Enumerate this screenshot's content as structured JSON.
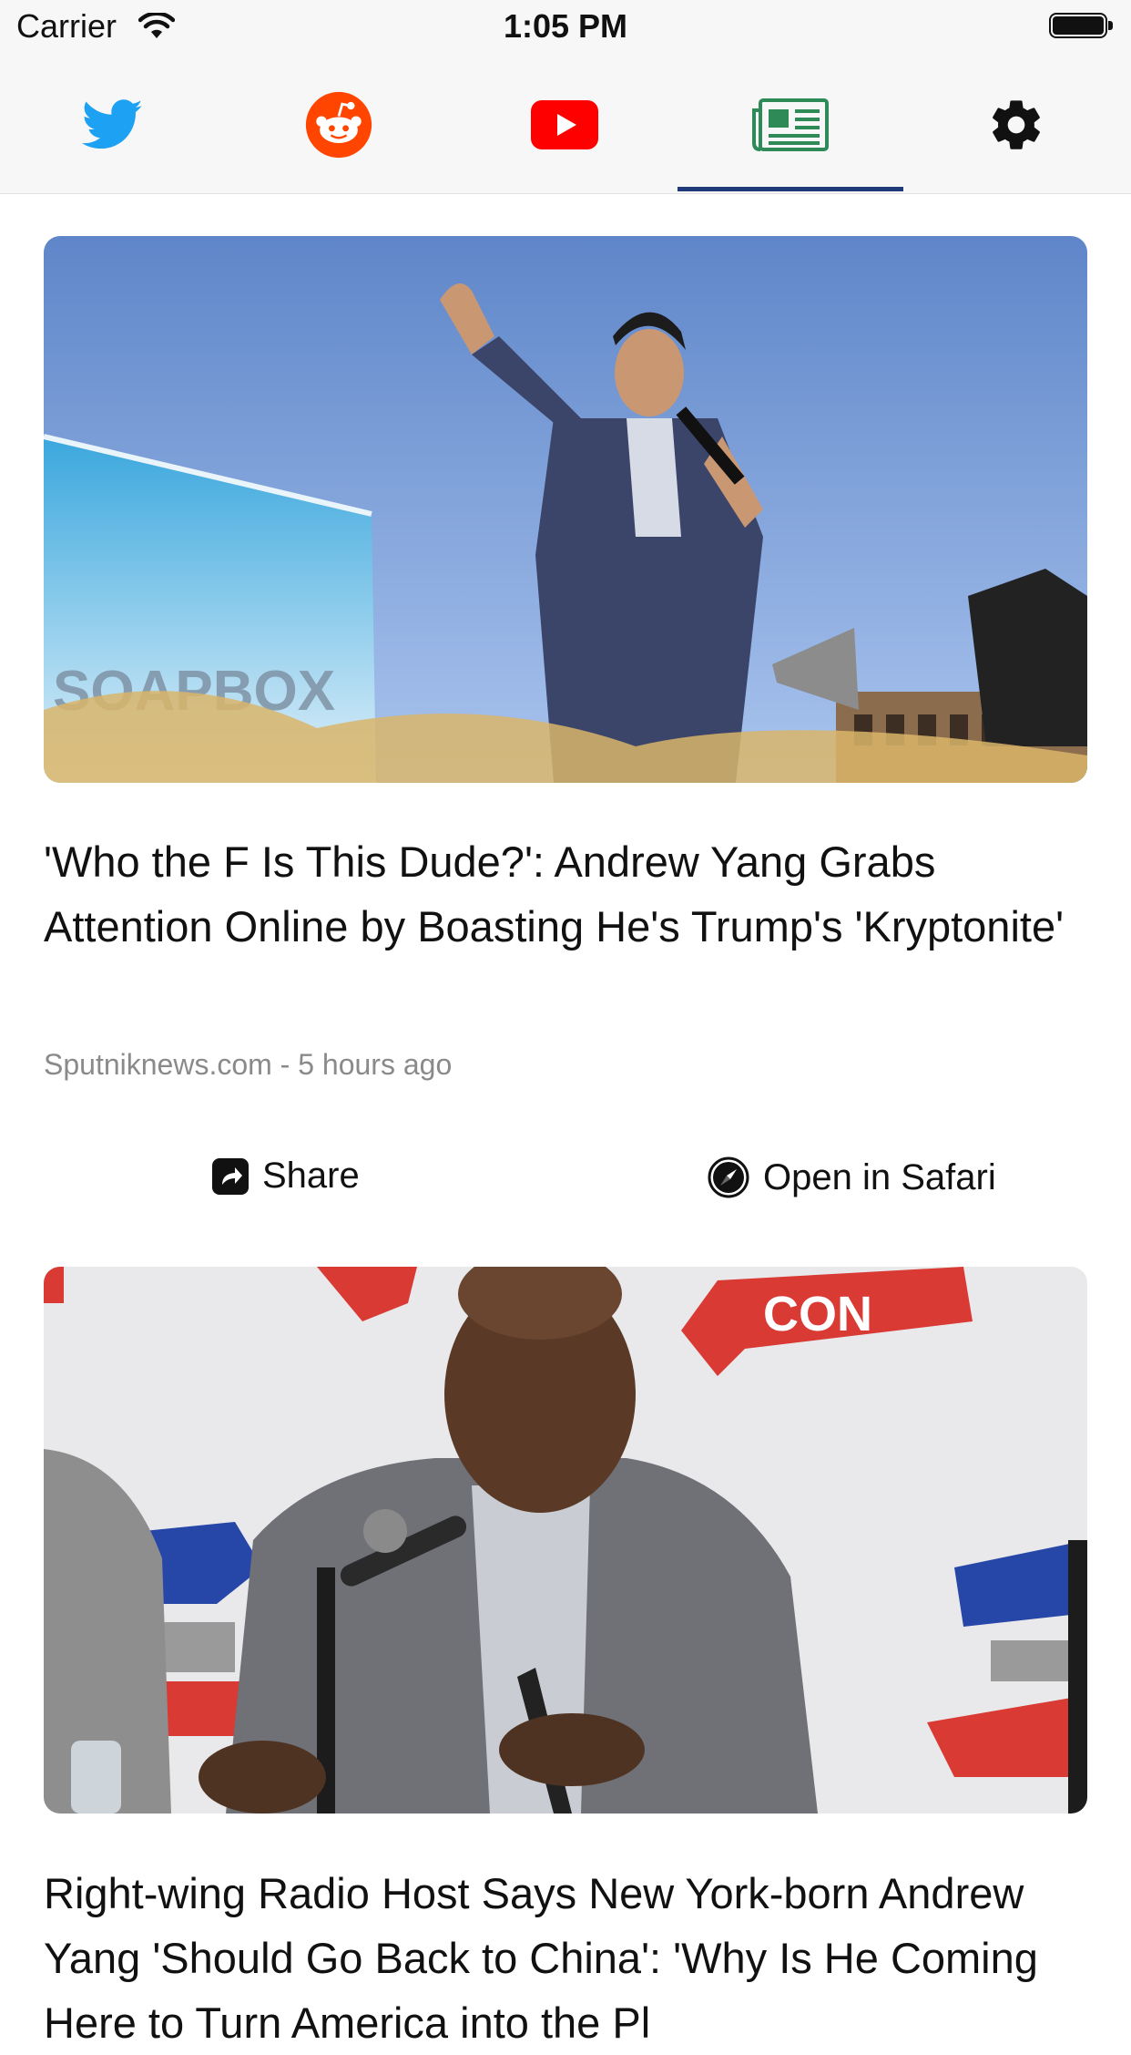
{
  "status_bar": {
    "carrier": "Carrier",
    "time": "1:05 PM"
  },
  "tabs": [
    {
      "icon": "twitter-icon",
      "color": "#1da1f2",
      "active": false
    },
    {
      "icon": "reddit-icon",
      "color": "#ff4500",
      "active": false
    },
    {
      "icon": "youtube-icon",
      "color": "#ff0000",
      "active": false
    },
    {
      "icon": "newspaper-icon",
      "color": "#2e8b57",
      "active": true
    },
    {
      "icon": "gear-icon",
      "color": "#111111",
      "active": false
    }
  ],
  "articles": [
    {
      "headline": "'Who the F Is This Dude?': Andrew Yang Grabs Attention Online by Boasting He's Trump's 'Kryptonite'",
      "meta": "Sputniknews.com - 5 hours ago",
      "image_banner_text": "SOAPBOX",
      "share_label": "Share",
      "safari_label": "Open in Safari"
    },
    {
      "headline": "Right-wing Radio Host Says New York-born Andrew Yang 'Should Go Back to China': 'Why Is He Coming Here to Turn America into the Pl",
      "image_banner_text": "CON"
    }
  ],
  "colors": {
    "accent_underline": "#1f3a78",
    "meta_text": "#8a8a8a"
  }
}
